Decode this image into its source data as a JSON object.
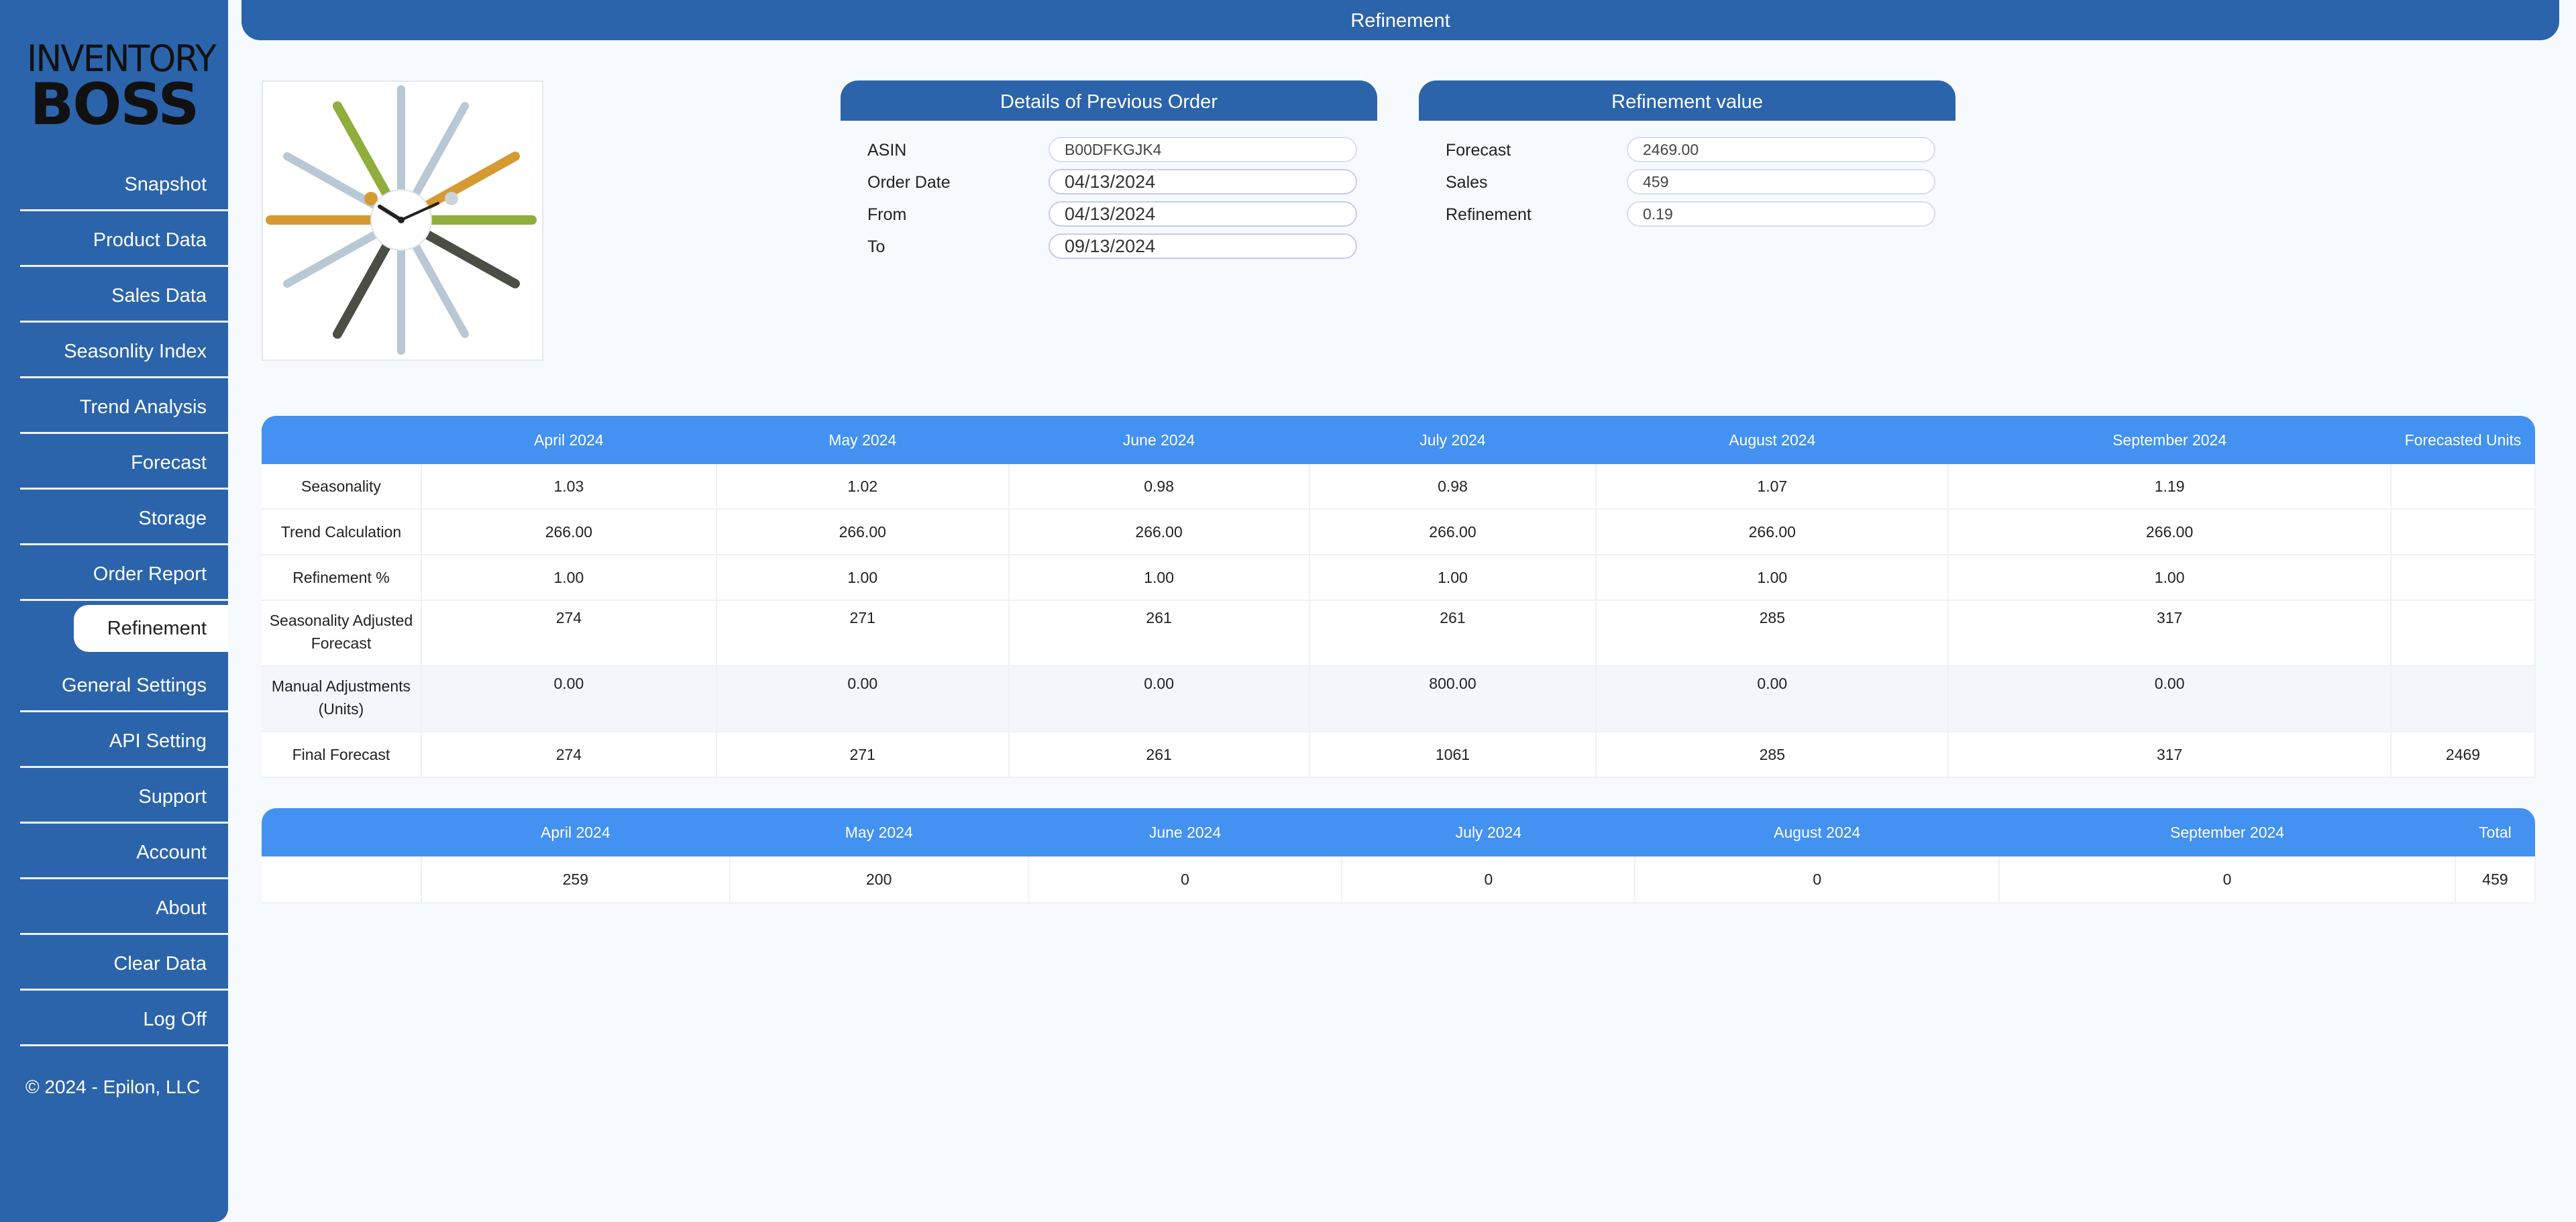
{
  "brand": {
    "line1": "INVENTORY",
    "line2": "BOSS"
  },
  "sidebar": {
    "items": [
      {
        "label": "Snapshot"
      },
      {
        "label": "Product Data"
      },
      {
        "label": "Sales Data"
      },
      {
        "label": "Seasonlity Index"
      },
      {
        "label": "Trend Analysis"
      },
      {
        "label": "Forecast"
      },
      {
        "label": "Storage"
      },
      {
        "label": "Order Report"
      },
      {
        "label": "Refinement"
      },
      {
        "label": "General Settings"
      },
      {
        "label": "API Setting"
      },
      {
        "label": "Support"
      },
      {
        "label": "Account"
      },
      {
        "label": "About"
      },
      {
        "label": "Clear Data"
      },
      {
        "label": "Log Off"
      }
    ],
    "active": "Refinement",
    "footer": "© 2024 - Epilon, LLC"
  },
  "header": {
    "title": "Refinement"
  },
  "product": {
    "image": "starburst-wall-clock"
  },
  "previous_order": {
    "title": "Details of Previous Order",
    "fields": [
      {
        "label": "ASIN",
        "value": "B00DFKGJK4"
      },
      {
        "label": "Order Date",
        "value": "04/13/2024"
      },
      {
        "label": "From",
        "value": "04/13/2024"
      },
      {
        "label": "To",
        "value": "09/13/2024"
      }
    ]
  },
  "refinement_value": {
    "title": "Refinement value",
    "fields": [
      {
        "label": "Forecast",
        "value": "2469.00"
      },
      {
        "label": "Sales",
        "value": "459"
      },
      {
        "label": "Refinement",
        "value": "0.19"
      }
    ]
  },
  "forecast_table": {
    "headers": [
      "",
      "April 2024",
      "May 2024",
      "June 2024",
      "July 2024",
      "August 2024",
      "September 2024",
      "Forecasted Units"
    ],
    "rows": [
      {
        "label": "Seasonality",
        "cells": [
          "1.03",
          "1.02",
          "0.98",
          "0.98",
          "1.07",
          "1.19",
          ""
        ]
      },
      {
        "label": "Trend Calculation",
        "cells": [
          "266.00",
          "266.00",
          "266.00",
          "266.00",
          "266.00",
          "266.00",
          ""
        ]
      },
      {
        "label": "Refinement %",
        "cells": [
          "1.00",
          "1.00",
          "1.00",
          "1.00",
          "1.00",
          "1.00",
          ""
        ]
      },
      {
        "label": "Seasonality Adjusted Forecast",
        "cells": [
          "274",
          "271",
          "261",
          "261",
          "285",
          "317",
          ""
        ]
      },
      {
        "label": "Manual Adjustments (Units)",
        "cells": [
          "0.00",
          "0.00",
          "0.00",
          "800.00",
          "0.00",
          "0.00",
          ""
        ]
      },
      {
        "label": "Final Forecast",
        "cells": [
          "274",
          "271",
          "261",
          "1061",
          "285",
          "317",
          "2469"
        ]
      }
    ]
  },
  "sales_table": {
    "headers": [
      "",
      "April 2024",
      "May 2024",
      "June 2024",
      "July 2024",
      "August 2024",
      "September 2024",
      "Total"
    ],
    "rows": [
      {
        "label": "",
        "cells": [
          "259",
          "200",
          "0",
          "0",
          "0",
          "0",
          "459"
        ]
      }
    ]
  },
  "colors": {
    "sidebar": "#2b64ab",
    "table_header": "#4391f0",
    "background": "#f6fafd"
  }
}
